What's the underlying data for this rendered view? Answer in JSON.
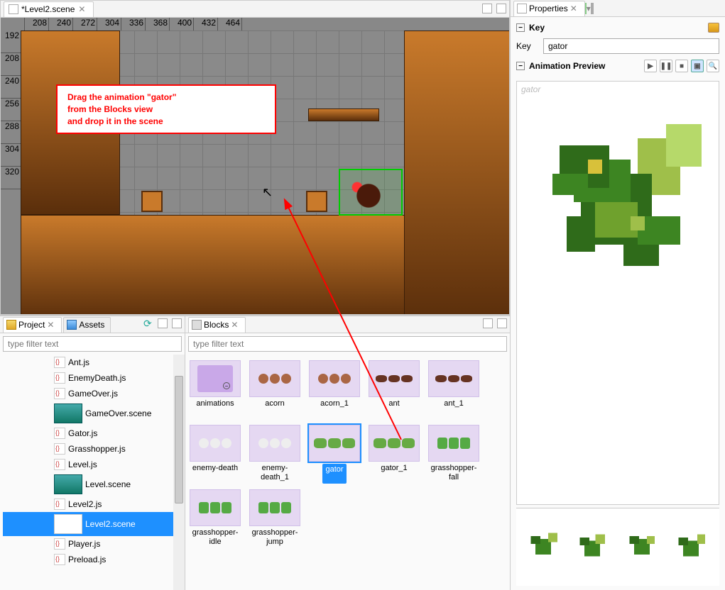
{
  "scene_tab": {
    "title": "*Level2.scene"
  },
  "ruler_top": [
    "",
    "208",
    "240",
    "272",
    "304",
    "336",
    "368",
    "400",
    "432",
    "464"
  ],
  "ruler_left": [
    "192",
    "208",
    "240",
    "256",
    "288",
    "304",
    "320"
  ],
  "callout": {
    "line1": "Drag the animation \"gator\"",
    "line2": "from the Blocks view",
    "line3": "and drop it in the scene"
  },
  "project": {
    "tab_project": "Project",
    "tab_assets": "Assets",
    "filter_placeholder": "type filter text",
    "tree": [
      {
        "label": "Ant.js",
        "type": "js"
      },
      {
        "label": "EnemyDeath.js",
        "type": "js"
      },
      {
        "label": "GameOver.js",
        "type": "js"
      },
      {
        "label": "GameOver.scene",
        "type": "scene-big"
      },
      {
        "label": "Gator.js",
        "type": "js"
      },
      {
        "label": "Grasshopper.js",
        "type": "js"
      },
      {
        "label": "Level.js",
        "type": "js"
      },
      {
        "label": "Level.scene",
        "type": "scene-big"
      },
      {
        "label": "Level2.js",
        "type": "js"
      },
      {
        "label": "Level2.scene",
        "type": "scene-sel"
      },
      {
        "label": "Player.js",
        "type": "js"
      },
      {
        "label": "Preload.js",
        "type": "js"
      }
    ]
  },
  "blocks": {
    "tab_label": "Blocks",
    "filter_placeholder": "type filter text",
    "items": [
      {
        "label": "animations",
        "thumb": "folder"
      },
      {
        "label": "acorn",
        "thumb": "brown"
      },
      {
        "label": "acorn_1",
        "thumb": "brown"
      },
      {
        "label": "ant",
        "thumb": "ant"
      },
      {
        "label": "ant_1",
        "thumb": "ant"
      },
      {
        "label": "enemy-death",
        "thumb": "smoke"
      },
      {
        "label": "enemy-death_1",
        "thumb": "smoke"
      },
      {
        "label": "gator",
        "thumb": "gator",
        "selected": true
      },
      {
        "label": "gator_1",
        "thumb": "gator"
      },
      {
        "label": "grasshopper-fall",
        "thumb": "hopper"
      },
      {
        "label": "grasshopper-idle",
        "thumb": "hopper"
      },
      {
        "label": "grasshopper-jump",
        "thumb": "hopper"
      }
    ]
  },
  "props": {
    "tab_label": "Properties",
    "section_key": "Key",
    "key_label": "Key",
    "key_value": "gator",
    "section_preview": "Animation Preview",
    "preview_placeholder": "gator"
  }
}
